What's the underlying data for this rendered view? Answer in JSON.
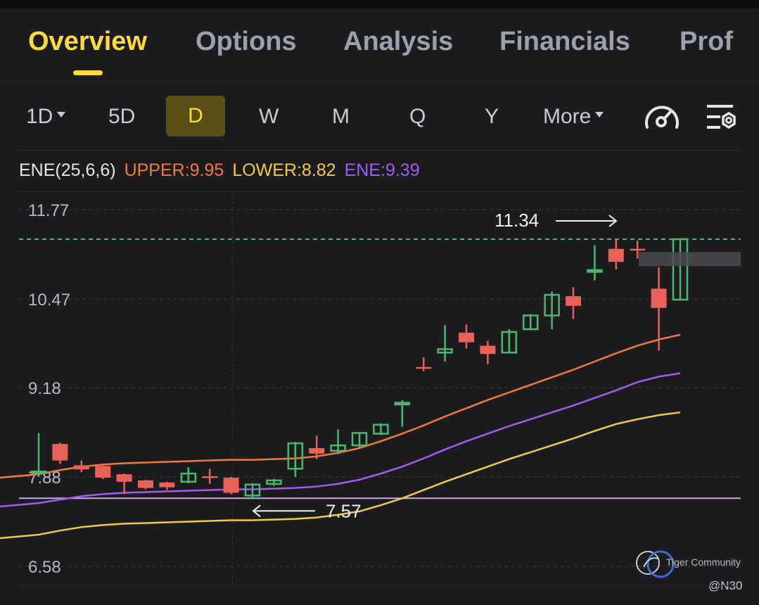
{
  "tabs": [
    "Overview",
    "Options",
    "Analysis",
    "Financials",
    "Prof"
  ],
  "active_tab": "Overview",
  "periods": {
    "p1d": "1D",
    "p5d": "5D",
    "pd": "D",
    "pw": "W",
    "pm": "M",
    "pq": "Q",
    "py": "Y",
    "more": "More"
  },
  "active_period": "D",
  "icons": [
    "gauge-icon",
    "indicator-settings-icon"
  ],
  "indicator": {
    "name": "ENE(25,6,6)",
    "upper": "UPPER:9.95",
    "lower": "LOWER:8.82",
    "ene": "ENE:9.39"
  },
  "colors": {
    "accent": "#ffd93d",
    "up": "#4cb86f",
    "down": "#e8625a",
    "upper": "#f07a3f",
    "lower": "#f2c94c",
    "ene": "#a35cf0"
  },
  "watermark": "Tiger Community",
  "handle": "@N30",
  "chart_data": {
    "type": "candlestick",
    "y_ticks": [
      "11.77",
      "10.47",
      "9.18",
      "7.88",
      "6.58"
    ],
    "ylim": [
      6.58,
      11.77
    ],
    "high_label": "11.34",
    "low_label": "7.57",
    "high_value": 11.34,
    "low_value": 7.57,
    "candles": [
      {
        "o": 7.95,
        "h": 8.52,
        "l": 7.88,
        "c": 7.96
      },
      {
        "o": 8.36,
        "h": 8.38,
        "l": 8.07,
        "c": 8.12
      },
      {
        "o": 8.05,
        "h": 8.12,
        "l": 7.95,
        "c": 7.99
      },
      {
        "o": 8.04,
        "h": 8.06,
        "l": 7.85,
        "c": 7.87
      },
      {
        "o": 7.92,
        "h": 7.93,
        "l": 7.63,
        "c": 7.81
      },
      {
        "o": 7.83,
        "h": 7.84,
        "l": 7.7,
        "c": 7.72
      },
      {
        "o": 7.8,
        "h": 7.81,
        "l": 7.69,
        "c": 7.73
      },
      {
        "o": 7.81,
        "h": 8.02,
        "l": 7.79,
        "c": 7.93
      },
      {
        "o": 7.89,
        "h": 8.0,
        "l": 7.78,
        "c": 7.87
      },
      {
        "o": 7.87,
        "h": 7.88,
        "l": 7.63,
        "c": 7.65
      },
      {
        "o": 7.61,
        "h": 7.79,
        "l": 7.57,
        "c": 7.77
      },
      {
        "o": 7.78,
        "h": 7.85,
        "l": 7.75,
        "c": 7.83
      },
      {
        "o": 8.0,
        "h": 8.39,
        "l": 7.88,
        "c": 8.37
      },
      {
        "o": 8.3,
        "h": 8.48,
        "l": 8.14,
        "c": 8.22
      },
      {
        "o": 8.26,
        "h": 8.57,
        "l": 8.21,
        "c": 8.34
      },
      {
        "o": 8.34,
        "h": 8.53,
        "l": 8.31,
        "c": 8.52
      },
      {
        "o": 8.51,
        "h": 8.66,
        "l": 8.49,
        "c": 8.64
      },
      {
        "o": 8.95,
        "h": 9.0,
        "l": 8.61,
        "c": 8.96
      },
      {
        "o": 9.48,
        "h": 9.62,
        "l": 9.42,
        "c": 9.47
      },
      {
        "o": 9.69,
        "h": 10.09,
        "l": 9.56,
        "c": 9.74
      },
      {
        "o": 9.98,
        "h": 10.1,
        "l": 9.75,
        "c": 9.84
      },
      {
        "o": 9.79,
        "h": 9.86,
        "l": 9.52,
        "c": 9.67
      },
      {
        "o": 9.69,
        "h": 10.03,
        "l": 9.69,
        "c": 9.99
      },
      {
        "o": 10.03,
        "h": 10.25,
        "l": 10.02,
        "c": 10.23
      },
      {
        "o": 10.23,
        "h": 10.58,
        "l": 10.03,
        "c": 10.53
      },
      {
        "o": 10.51,
        "h": 10.64,
        "l": 10.18,
        "c": 10.37
      },
      {
        "o": 10.88,
        "h": 11.25,
        "l": 10.74,
        "c": 10.89
      },
      {
        "o": 11.2,
        "h": 11.34,
        "l": 10.9,
        "c": 11.01
      },
      {
        "o": 11.2,
        "h": 11.32,
        "l": 11.06,
        "c": 11.19
      },
      {
        "o": 10.62,
        "h": 10.93,
        "l": 9.72,
        "c": 10.34
      },
      {
        "o": 10.46,
        "h": 11.34,
        "l": 10.46,
        "c": 11.34
      }
    ],
    "series": [
      {
        "name": "UPPER",
        "values": [
          7.92,
          7.98,
          8.03,
          8.06,
          8.08,
          8.09,
          8.1,
          8.11,
          8.12,
          8.13,
          8.13,
          8.14,
          8.15,
          8.18,
          8.23,
          8.3,
          8.4,
          8.51,
          8.63,
          8.76,
          8.88,
          9.0,
          9.11,
          9.22,
          9.33,
          9.44,
          9.56,
          9.68,
          9.79,
          9.88,
          9.95
        ]
      },
      {
        "name": "ENE",
        "values": [
          7.5,
          7.55,
          7.6,
          7.63,
          7.65,
          7.66,
          7.67,
          7.68,
          7.69,
          7.7,
          7.7,
          7.71,
          7.72,
          7.74,
          7.78,
          7.84,
          7.93,
          8.03,
          8.15,
          8.28,
          8.4,
          8.51,
          8.62,
          8.72,
          8.82,
          8.92,
          9.03,
          9.14,
          9.26,
          9.34,
          9.39
        ]
      },
      {
        "name": "LOWER",
        "values": [
          7.04,
          7.1,
          7.15,
          7.18,
          7.2,
          7.21,
          7.22,
          7.23,
          7.24,
          7.25,
          7.25,
          7.26,
          7.27,
          7.29,
          7.33,
          7.38,
          7.47,
          7.57,
          7.69,
          7.81,
          7.92,
          8.03,
          8.14,
          8.24,
          8.34,
          8.44,
          8.55,
          8.65,
          8.72,
          8.78,
          8.82
        ]
      }
    ],
    "ref_lines": [
      {
        "value": 11.34,
        "style": "dashed",
        "color": "#4cb86f"
      },
      {
        "value": 7.57,
        "style": "solid",
        "color": "#c9a8e0"
      }
    ],
    "grid": true
  }
}
